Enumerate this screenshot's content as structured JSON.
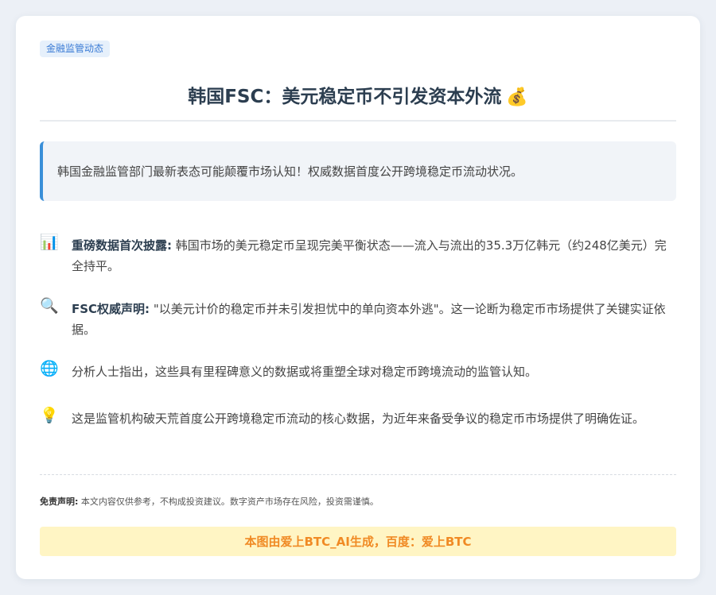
{
  "tag": "金融监管动态",
  "title": "韩国FSC：美元稳定币不引发资本外流",
  "title_icon": "💰",
  "intro": "韩国金融监管部门最新表态可能颠覆市场认知！权威数据首度公开跨境稳定币流动状况。",
  "items": [
    {
      "icon": "📊",
      "icon_name": "bar-chart-icon",
      "bold": "重磅数据首次披露:",
      "text": " 韩国市场的美元稳定币呈现完美平衡状态——流入与流出的35.3万亿韩元（约248亿美元）完全持平。"
    },
    {
      "icon": "🔍",
      "icon_name": "magnifier-icon",
      "bold": "FSC权威声明:",
      "text": " \"以美元计价的稳定币并未引发担忧中的单向资本外逃\"。这一论断为稳定币市场提供了关键实证依据。"
    },
    {
      "icon": "🌐",
      "icon_name": "globe-icon",
      "bold": "",
      "text": "分析人士指出，这些具有里程碑意义的数据或将重塑全球对稳定币跨境流动的监管认知。"
    },
    {
      "icon": "💡",
      "icon_name": "lightbulb-icon",
      "bold": "",
      "text": "这是监管机构破天荒首度公开跨境稳定币流动的核心数据，为近年来备受争议的稳定币市场提供了明确佐证。"
    }
  ],
  "disclaimer": {
    "label": "免责声明:",
    "text": " 本文内容仅供参考，不构成投资建议。数字资产市场存在风险，投资需谨慎。"
  },
  "banner": "本图由爱上BTC_AI生成，百度：爱上BTC",
  "colors": {
    "accent": "#3a8fd8",
    "title": "#2c3e50",
    "banner_bg": "#fff5c4",
    "banner_text": "#f08a24"
  }
}
